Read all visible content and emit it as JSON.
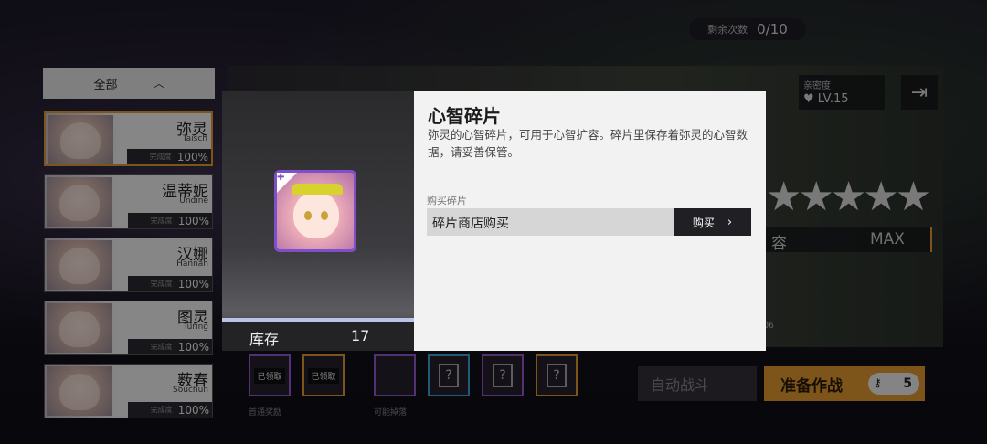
{
  "top": {
    "remaining_label": "剩余次数",
    "remaining_value": "0/10"
  },
  "filter": {
    "label": "全部",
    "caret": "︿"
  },
  "characters": [
    {
      "cn": "弥灵",
      "en": "Taisch",
      "comp_label": "完成度",
      "pct": "100%",
      "star": true
    },
    {
      "cn": "温蒂妮",
      "en": "Undine",
      "comp_label": "完成度",
      "pct": "100%",
      "star": true
    },
    {
      "cn": "汉娜",
      "en": "Hannah",
      "comp_label": "完成度",
      "pct": "100%",
      "star": false
    },
    {
      "cn": "图灵",
      "en": "Turing",
      "comp_label": "完成度",
      "pct": "100%",
      "star": false
    },
    {
      "cn": "薮春",
      "en": "Souchun",
      "comp_label": "完成度",
      "pct": "100%",
      "star": false
    }
  ],
  "background": {
    "intimacy_label": "亲密度",
    "intimacy_level": "LV.15",
    "stars": "★★★★★",
    "cap_left": "容",
    "cap_right": "MAX",
    "sp_label": "P06"
  },
  "rewards": {
    "claimed_1": "已领取",
    "claimed_2": "已领取",
    "first_label": "首通奖励",
    "maybe_label": "可能掉落"
  },
  "actions": {
    "auto_battle": "自动战斗",
    "ready": "准备作战",
    "cost": "5"
  },
  "modal": {
    "title": "心智碎片",
    "description": "弥灵的心智碎片，可用于心智扩容。碎片里保存着弥灵的心智数据，请妥善保管。",
    "section_label": "购买碎片",
    "shop_label": "碎片商店购买",
    "buy_label": "购买",
    "stock_label": "库存",
    "stock_value": "17"
  }
}
